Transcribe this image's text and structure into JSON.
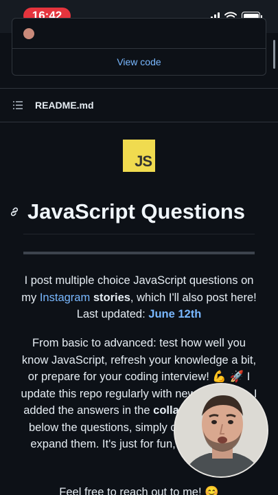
{
  "status": {
    "time": "16:42"
  },
  "repo_card": {
    "view_code_label": "View code"
  },
  "readme": {
    "file_name": "README.md",
    "logo_text": "JS",
    "title": "JavaScript Questions"
  },
  "intro": {
    "t1": "I post multiple choice JavaScript questions on my ",
    "instagram": "Instagram",
    "t2": " ",
    "stories": "stories",
    "t3": ", which I'll also post here! Last updated: ",
    "date": "June 12th"
  },
  "para2": {
    "t1": "From basic to advanced: test how well you know JavaScript, refresh your knowledge a bit, or prepare for your coding interview! 💪 🚀 I update this repo regularly with new questions. I added the answers in the ",
    "collapsed": "collapsed sections",
    "t2": " below the questions, simply click on them to expand them. It's just for fun, good luck! ❤️"
  },
  "para3": {
    "text": "Feel free to reach out to me! 😊"
  },
  "colors": {
    "background": "#0d1117",
    "link": "#79b8ff",
    "time_pill": "#e5343d",
    "js_yellow": "#f0db4f"
  }
}
